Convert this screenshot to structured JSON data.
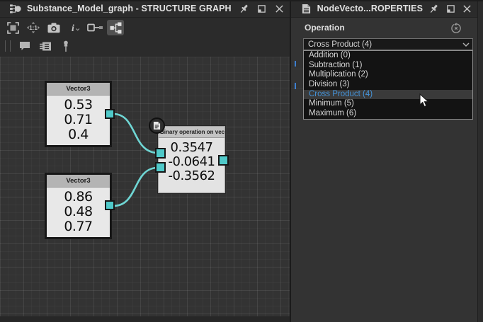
{
  "left_panel": {
    "title": "Substance_Model_graph - STRUCTURE GRAPH",
    "titlebar_icons": [
      "structure-graph-icon",
      "pin-icon",
      "float-panel-icon",
      "close-icon"
    ],
    "toolbar_icons": [
      "fit-view-icon",
      "zoom-actual-size-icon",
      "screenshot-icon",
      "info-icon",
      "link-display-icon",
      "graph-view-icon",
      "comment-icon",
      "node-display-icon",
      "pin-node-icon"
    ],
    "active_tool": "graph-view-icon",
    "nodes": [
      {
        "title": "Vector3",
        "values": [
          "0.53",
          "0.71",
          "0.4"
        ]
      },
      {
        "title": "Vector3",
        "values": [
          "0.86",
          "0.48",
          "0.77"
        ]
      },
      {
        "title": "Binary operation on vec...",
        "values": [
          "0.3547",
          "-0.0641",
          "-0.3562"
        ]
      }
    ]
  },
  "right_panel": {
    "title": "NodeVecto...ROPERTIES",
    "titlebar_icons": [
      "properties-document-icon",
      "pin-icon",
      "float-panel-icon",
      "close-icon"
    ],
    "operation": {
      "label": "Operation",
      "value": "Cross Product (4)",
      "options": [
        "Addition (0)",
        "Subtraction (1)",
        "Multiplication (2)",
        "Division (3)",
        "Cross Product (4)",
        "Minimum (5)",
        "Maximum (6)"
      ],
      "selected_option": "Cross Product (4)",
      "selected_index": 4
    }
  },
  "colors": {
    "wire_teal": "#6fd6d4",
    "port_teal": "#4fc9c9",
    "selection_blue": "#4593d8",
    "titlebar_bg": "#2b2b2b",
    "panel_bg": "#333333"
  }
}
